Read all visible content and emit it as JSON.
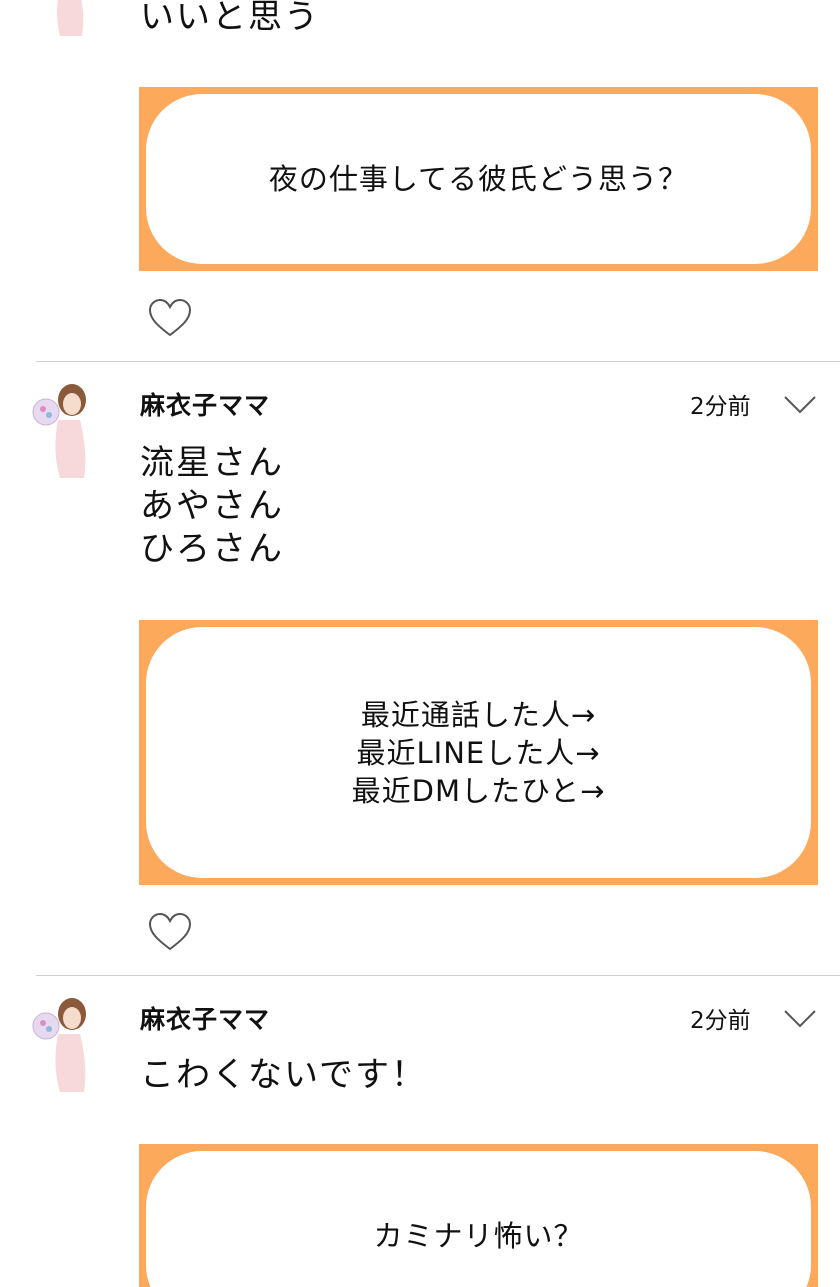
{
  "posts": [
    {
      "body": "いいと思う",
      "card": "夜の仕事してる彼氏どう思う？"
    },
    {
      "username": "麻衣子ママ",
      "time": "2分前",
      "body": "流星さん\nあやさん\nひろさん",
      "card": "最近通話した人→\n最近LINEした人→\n最近DMしたひと→"
    },
    {
      "username": "麻衣子ママ",
      "time": "2分前",
      "body": "こわくないです！",
      "card": "カミナリ怖い？"
    }
  ],
  "colors": {
    "card_border": "#fca95c",
    "divider": "#cfcfcf",
    "icon_stroke": "#555555"
  },
  "icons": {
    "like": "heart-outline-icon",
    "menu": "chevron-down-icon",
    "avatar": "user-avatar-photo"
  }
}
